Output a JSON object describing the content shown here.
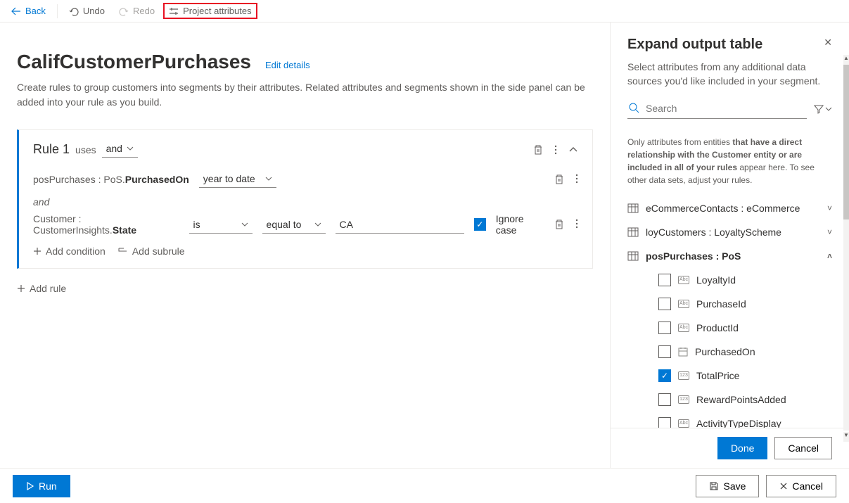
{
  "toolbar": {
    "back": "Back",
    "undo": "Undo",
    "redo": "Redo",
    "project_attributes": "Project attributes"
  },
  "page": {
    "title": "CalifCustomerPurchases",
    "edit_details": "Edit details",
    "description": "Create rules to group customers into segments by their attributes. Related attributes and segments shown in the side panel can be added into your rule as you build."
  },
  "rule": {
    "name": "Rule 1",
    "uses": "uses",
    "logic": "and",
    "conditions": [
      {
        "attr_prefix": "posPurchases : PoS.",
        "attr_bold": "PurchasedOn",
        "op1": "year to date"
      },
      {
        "attr_prefix": "Customer : CustomerInsights.",
        "attr_bold": "State",
        "op1": "is",
        "op2": "equal to",
        "value": "CA",
        "ignore_case": "Ignore case"
      }
    ],
    "and_label": "and",
    "add_condition": "Add condition",
    "add_subrule": "Add subrule",
    "add_rule": "Add rule"
  },
  "panel": {
    "title": "Expand output table",
    "description": "Select attributes from any additional data sources you'd like included in your segment.",
    "search_placeholder": "Search",
    "note_pre": "Only attributes from entities ",
    "note_bold1": "that have a direct relationship with the Customer entity or are included in all of your rules",
    "note_post": " appear here. To see other data sets, adjust your rules.",
    "entities": [
      {
        "name": "eCommerceContacts : eCommerce",
        "expanded": false
      },
      {
        "name": "loyCustomers : LoyaltyScheme",
        "expanded": false
      },
      {
        "name": "posPurchases : PoS",
        "expanded": true,
        "attrs": [
          {
            "name": "LoyaltyId",
            "type": "abc",
            "checked": false
          },
          {
            "name": "PurchaseId",
            "type": "abc",
            "checked": false
          },
          {
            "name": "ProductId",
            "type": "abc",
            "checked": false
          },
          {
            "name": "PurchasedOn",
            "type": "date",
            "checked": false
          },
          {
            "name": "TotalPrice",
            "type": "num",
            "checked": true
          },
          {
            "name": "RewardPointsAdded",
            "type": "num",
            "checked": false
          },
          {
            "name": "ActivityTypeDisplay",
            "type": "abc",
            "checked": false
          }
        ]
      }
    ],
    "done": "Done",
    "cancel": "Cancel"
  },
  "footer": {
    "run": "Run",
    "save": "Save",
    "cancel": "Cancel"
  }
}
